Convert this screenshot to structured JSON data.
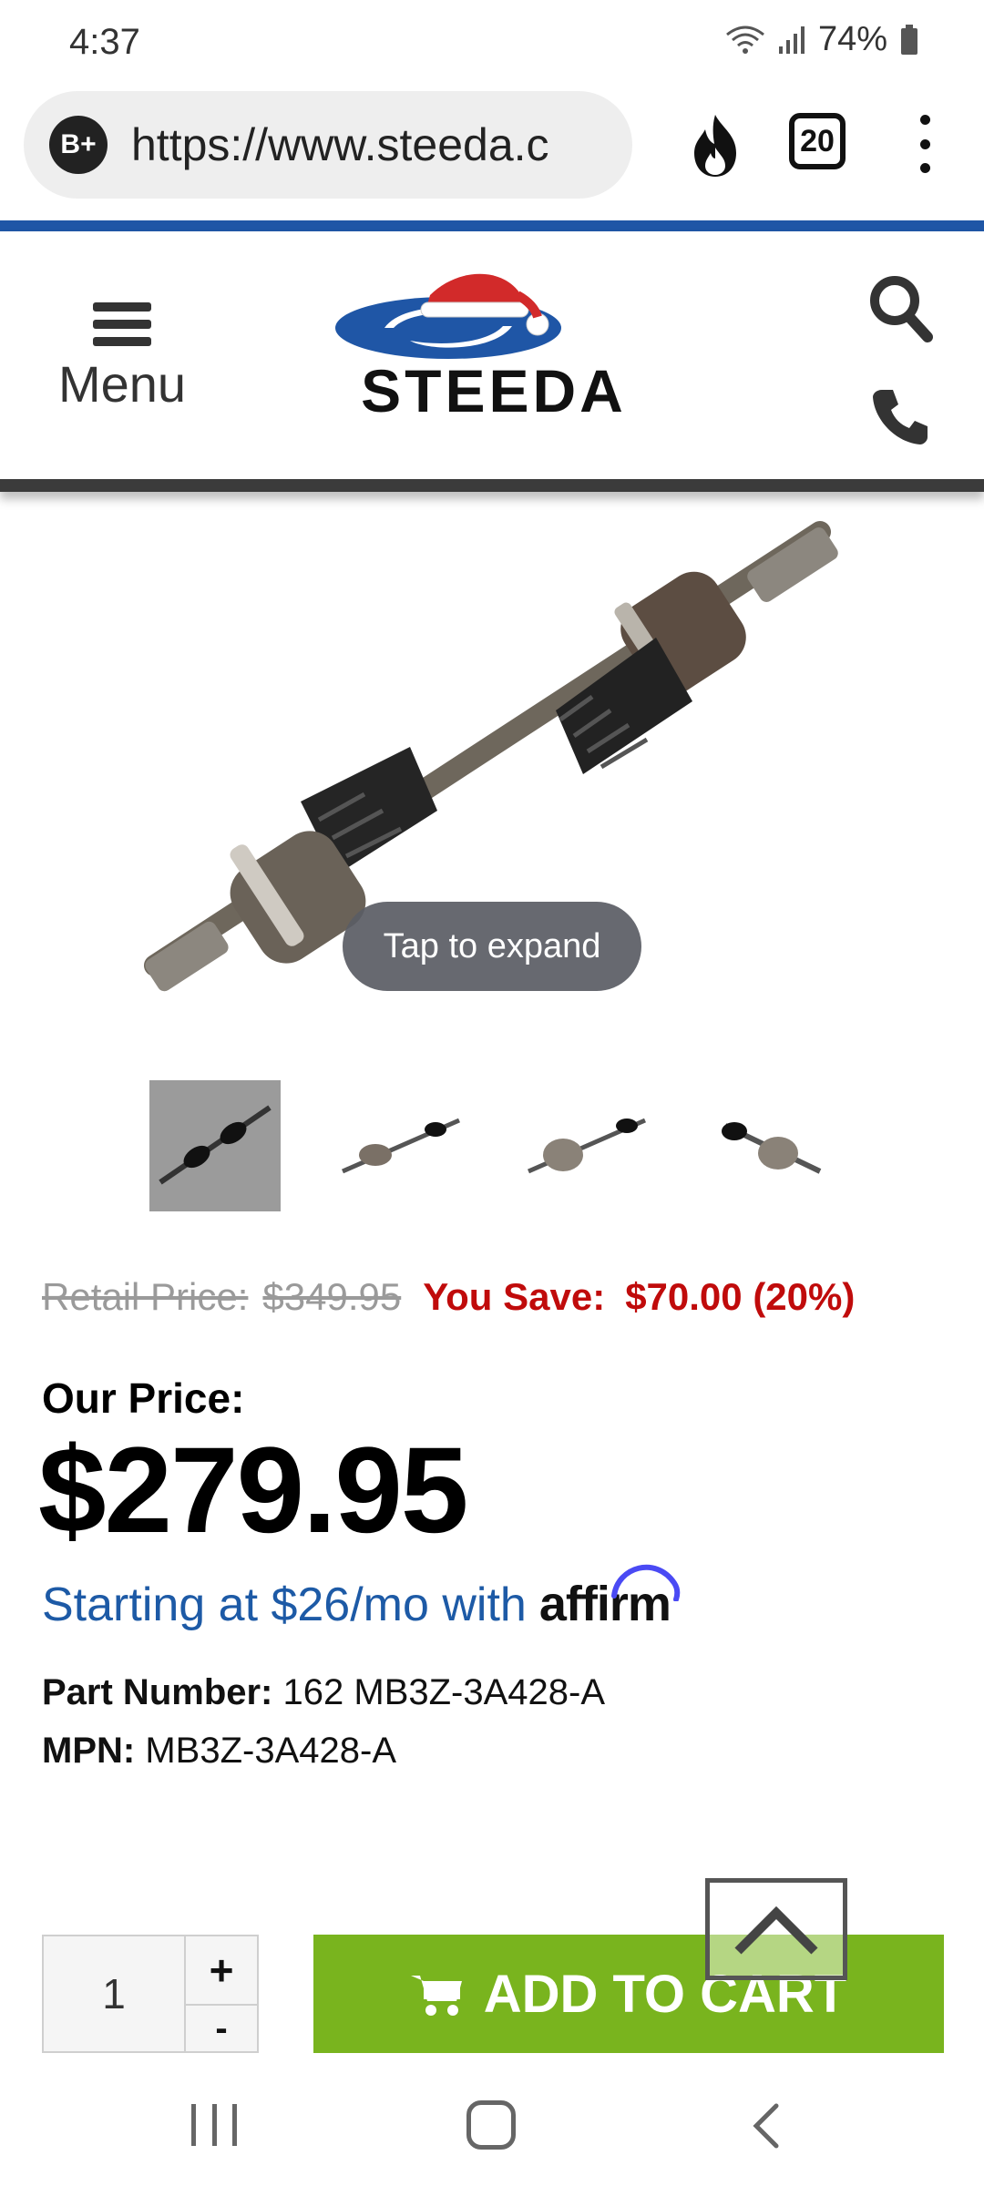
{
  "status_bar": {
    "time": "4:37",
    "battery": "74%"
  },
  "browser": {
    "url": "https://www.steeda.c",
    "tab_count": "20",
    "badge_label": "B+"
  },
  "header": {
    "menu_label": "Menu",
    "logo_text": "STEEDA"
  },
  "product": {
    "expand_label": "Tap to expand",
    "thumbnail_count": 4,
    "retail_label": "Retail Price:",
    "retail_price": "$349.95",
    "save_label": "You Save:",
    "save_value": "$70.00 (20%)",
    "our_price_label": "Our Price:",
    "our_price": "$279.95",
    "financing_text": "Starting at $26/mo with",
    "financing_brand": "affirm",
    "part_number_label": "Part Number:",
    "part_number": "162 MB3Z-3A428-A",
    "mpn_label": "MPN:",
    "mpn": "MB3Z-3A428-A"
  },
  "cart": {
    "quantity": "1",
    "plus_label": "+",
    "minus_label": "-",
    "add_to_cart_label": "ADD TO CART"
  },
  "colors": {
    "brand_blue": "#1f56a6",
    "sale_red": "#c00b0b",
    "cart_green": "#79b41e",
    "affirm_purple": "#4a4af4"
  }
}
